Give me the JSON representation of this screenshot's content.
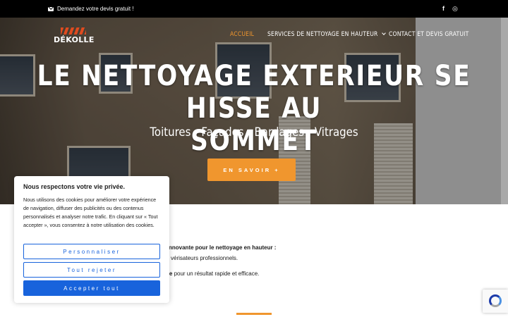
{
  "topbar": {
    "quote_text": "Demandez votre devis gratuit !",
    "icons": [
      "envelope-icon",
      "facebook-icon",
      "instagram-icon"
    ],
    "facebook_glyph": "f",
    "instagram_glyph": "◎"
  },
  "logo": {
    "text": "DÉKOLLE"
  },
  "nav": {
    "items": [
      {
        "label": "ACCUEIL",
        "active": true
      },
      {
        "label": "SERVICES DE NETTOYAGE EN HAUTEUR",
        "has_dropdown": true
      },
      {
        "label": "CONTACT ET DEVIS GRATUIT"
      }
    ]
  },
  "hero": {
    "title_line1": "LE NETTOYAGE EXTERIEUR SE HISSE AU",
    "title_line2": "SOMMET",
    "subtitle": "Toitures - Façades - Bardages - Vitrages",
    "button_label": "EN SAVOIR +"
  },
  "content": {
    "bold_line": "nnovante pour le nettoyage en hauteur :",
    "line1": "vérisateurs professionnels.",
    "line2_bold": "ge",
    "line2_rest": " pour un résultat rapide et efficace."
  },
  "cookie": {
    "title": "Nous respectons votre vie privée.",
    "body": "Nous utilisons des cookies pour améliorer votre expérience de navigation, diffuser des publicités ou des contenus personnalisés et analyser notre trafic. En cliquant sur « Tout accepter », vous consentez à notre utilisation des cookies.",
    "btn_customize": "Personnaliser",
    "btn_reject": "Tout rejeter",
    "btn_accept": "Accepter tout"
  },
  "colors": {
    "accent": "#f0962e",
    "cookie_blue": "#1863dc",
    "topbar": "#000000"
  }
}
